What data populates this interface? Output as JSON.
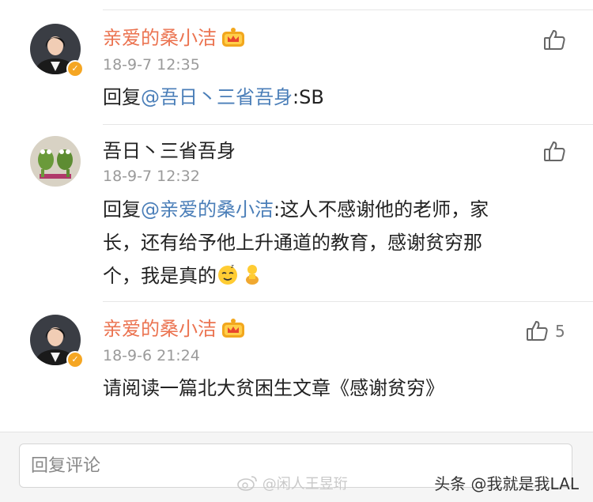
{
  "comments": [
    {
      "username": "亲爱的桑小洁",
      "time": "18-9-7 12:35",
      "reply_prefix": "回复",
      "mention": "@吾日丶三省吾身",
      "text": ":SB",
      "likes": ""
    },
    {
      "username": "吾日丶三省吾身",
      "time": "18-9-7 12:32",
      "reply_prefix": "回复",
      "mention": "@亲爱的桑小洁",
      "text_line1": ":这人不感谢他的老师，家",
      "text_line2": "长，还有给予他上升通道的教育，感谢贫穷那",
      "text_line3": "个，我是真的",
      "likes": ""
    },
    {
      "username": "亲爱的桑小洁",
      "time": "18-9-6 21:24",
      "text": "请阅读一篇北大贫困生文章《感谢贫穷》",
      "likes": "5"
    }
  ],
  "reply_box": {
    "placeholder": "回复评论"
  },
  "watermarks": {
    "weibo": "@闲人王昱珩",
    "toutiao": "头条 @我就是我LAL"
  },
  "colors": {
    "username_accent": "#eb7350",
    "mention": "#4a7eb8",
    "verified": "#f5a623"
  },
  "icons": [
    "crown-icon",
    "verified-badge-icon",
    "thumbs-up-icon",
    "weibo-logo-icon"
  ]
}
